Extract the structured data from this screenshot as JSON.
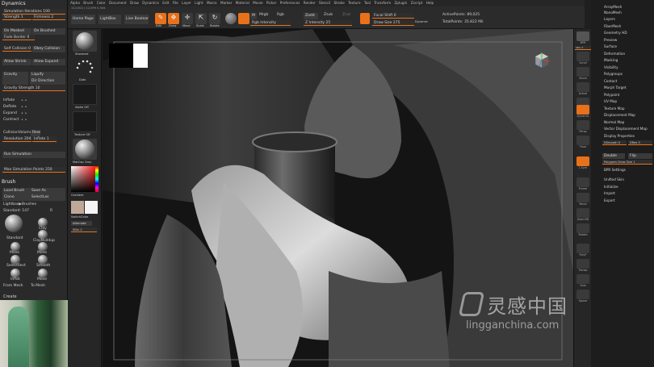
{
  "left_tray": {
    "dynamics_title": "Dynamics",
    "sim_iterations": "Simulation Iterations 100",
    "strength": "Strength 1",
    "firmness": "Firmness 2",
    "on_masked": "On Masked",
    "on_brushed": "On Brushed",
    "fade_border": "Fade Border 0",
    "self_collision": "Self Collision 0",
    "obey_collision": "Obey Collision",
    "allow_shrink": "Allow Shrink",
    "allow_expand": "Allow Expand",
    "gravity": "Gravity",
    "liquify": "Liquify",
    "dir_direction": "Dir Direction",
    "gravity_strength": "Gravity Strength 10",
    "inflate": "Inflate",
    "deflate": "Deflate",
    "expand": "Expand",
    "contract": "Contract",
    "collision_volume": "CollisionVolume",
    "reset": "Reset",
    "resolution": "Resolution 2048",
    "inflate_val": "Inflate 1",
    "run_simulation": "Run Simulation",
    "max_sim_points": "Max Simulation Points 250",
    "brush_title": "Brush",
    "load_brush": "Load Brush",
    "save_as": "Save As",
    "clone": "Clone",
    "selectlas": "SelectLas",
    "lightbox_brushes": "Lightbox▶Brushes",
    "standard_size": "Standard: 147",
    "standard_val": "R",
    "brushes": [
      "Standard",
      "Clay",
      "ClayBuildup",
      "Move",
      "Move",
      "SelectRect",
      "Smooth",
      "Inflat",
      "Move"
    ],
    "from_mesh": "From Mesh",
    "to_mesh": "To Mesh",
    "create_title": "Create"
  },
  "menu": [
    "Alpha",
    "Brush",
    "Color",
    "Document",
    "Draw",
    "Dynamics",
    "Edit",
    "File",
    "Layer",
    "Light",
    "Macro",
    "Marker",
    "Material",
    "Movie",
    "Picker",
    "Preferences",
    "Render",
    "Stencil",
    "Stroke",
    "Texture",
    "Tool",
    "Transform",
    "Zplugin",
    "Zscript",
    "Help"
  ],
  "top_shelf": {
    "subtitle": "112,002 / 12,099 0,344",
    "home_page": "Home Page",
    "lightbox": "LightBox",
    "live_boolean": "Live Boolean",
    "edit": "Edit",
    "draw": "Draw",
    "move": "Move",
    "scale": "Scale",
    "rotate": "Rotate",
    "mrgb": "Mrgb",
    "rgb": "Rgb",
    "m": "M",
    "zadd": "Zadd",
    "zsub": "Zsub",
    "zcut": "Zcut",
    "rgb_intensity": "Rgb Intensity",
    "z_intensity": "Z Intensity 25",
    "focal_shift": "Focal Shift 0",
    "draw_size": "Draw Size 275",
    "dynamic": "Dynamic",
    "active_points": "ActivePoints: 89,025",
    "total_points": "TotalPoints: 35.822 Mil"
  },
  "left_shelf": {
    "standard": "Standard",
    "dots": "Dots",
    "alpha_off": "Alpha Off",
    "texture_off": "Texture Off",
    "matcap_gray": "MatCap Gray",
    "gradient": "Gradient",
    "switch_color": "SwitchColor",
    "alternate": "Alternate",
    "sdiv": "SDiv 2"
  },
  "right_shelf": [
    "BPR",
    "SPix 3",
    "Scroll",
    "Zoom",
    "Actual",
    "AAHalf",
    "Dynamic",
    "Persp",
    "Floor",
    "L.Sym",
    "Frame",
    "Move",
    "Zoom3D",
    "Rotate",
    "PolyF",
    "Transp",
    "Solo",
    "Xpose"
  ],
  "right_tray": {
    "items": [
      "ArrayMesh",
      "NanoMesh",
      "Layers",
      "FiberMesh",
      "Geometry HD",
      "Preview",
      "Surface",
      "Deformation",
      "Masking",
      "Visibility",
      "Polygroups",
      "Contact",
      "Morph Target",
      "Polypaint",
      "UV Map",
      "Texture Map",
      "Displacement Map",
      "Normal Map",
      "Vector Displacement Map",
      "Display Properties"
    ],
    "dsmooth": "DSmooth 0",
    "dres": "DRes 3",
    "double": "Double",
    "flip": "Flip",
    "poly_draw_size": "Polygons Draw Size 1",
    "bpr_settings": "BPR Settings",
    "unified_skin": "Unified Skin",
    "initialize": "Initialize",
    "import": "Import",
    "export": "Export"
  },
  "watermark": {
    "cn": "灵感中国",
    "url": "lingganchina.com"
  },
  "colors": {
    "accent": "#e8711a",
    "panel": "#2a2a2a",
    "canvas": "#161616"
  }
}
